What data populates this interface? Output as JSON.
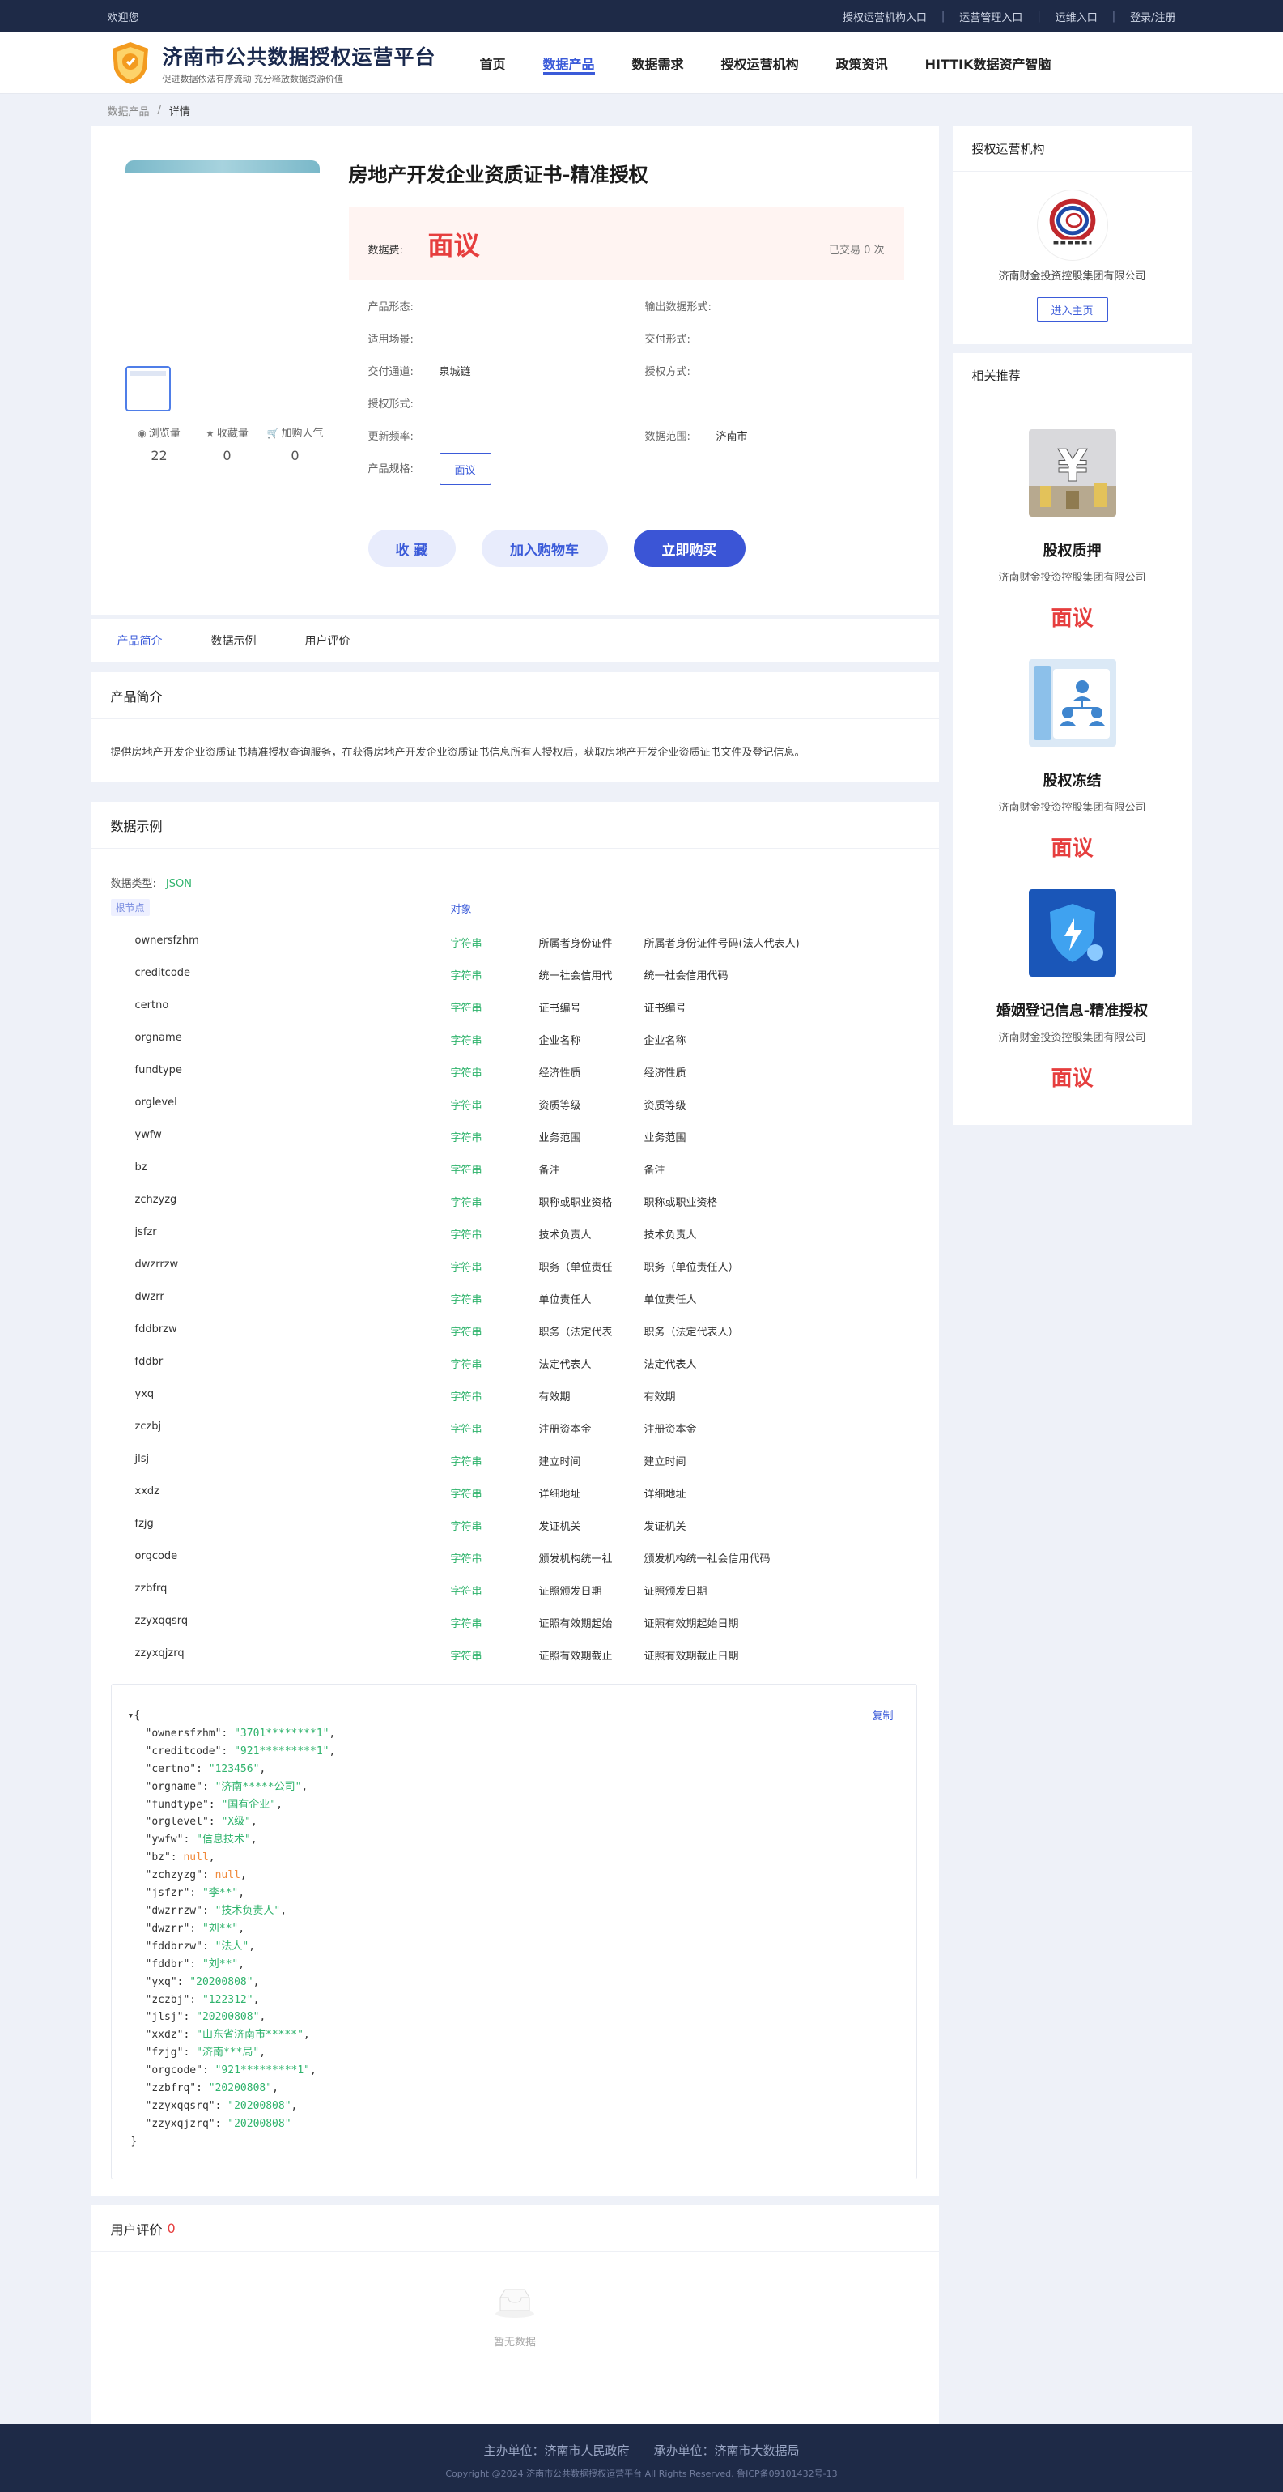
{
  "topbar": {
    "welcome": "欢迎您",
    "links": [
      "授权运营机构入口",
      "运营管理入口",
      "运维入口",
      "登录/注册"
    ]
  },
  "header": {
    "title": "济南市公共数据授权运营平台",
    "slogan": "促进数据依法有序流动 充分释放数据资源价值",
    "nav": [
      "首页",
      "数据产品",
      "数据需求",
      "授权运营机构",
      "政策资讯",
      "HITTIK数据资产智脑"
    ],
    "active_nav": "数据产品"
  },
  "breadcrumb": {
    "parent": "数据产品",
    "sep": "/",
    "current": "详情"
  },
  "product": {
    "title": "房地产开发企业资质证书-精准授权",
    "price_label": "数据费:",
    "price": "面议",
    "deals": "已交易 0 次",
    "stats": [
      {
        "label": "浏览量",
        "icon": "eye-icon",
        "value": "22"
      },
      {
        "label": "收藏量",
        "icon": "star-icon",
        "value": "0"
      },
      {
        "label": "加购人气",
        "icon": "cart-icon",
        "value": "0"
      }
    ],
    "attrs": {
      "form_label": "产品形态:",
      "form_value": "",
      "output_label": "输出数据形式:",
      "output_value": "",
      "scene_label": "适用场景:",
      "scene_value": "",
      "delivery_label": "交付形式:",
      "delivery_value": "",
      "channel_label": "交付通道:",
      "channel_value": "泉城链",
      "auth_method_label": "授权方式:",
      "auth_method_value": "",
      "auth_form_label": "授权形式:",
      "auth_form_value": "",
      "freq_label": "更新频率:",
      "freq_value": "",
      "range_label": "数据范围:",
      "range_value": "济南市",
      "spec_label": "产品规格:",
      "spec_value": "面议"
    },
    "buttons": {
      "fav": "收 藏",
      "cart": "加入购物车",
      "buy": "立即购买"
    }
  },
  "tabs": [
    "产品简介",
    "数据示例",
    "用户评价"
  ],
  "intro": {
    "title": "产品简介",
    "text": "提供房地产开发企业资质证书精准授权查询服务，在获得房地产开发企业资质证书信息所有人授权后，获取房地产开发企业资质证书文件及登记信息。"
  },
  "example": {
    "title": "数据示例",
    "type_label": "数据类型:",
    "type_value": "JSON",
    "root_tag": "根节点",
    "root_type": "对象",
    "fields": [
      {
        "name": "ownersfzhm",
        "type": "字符串",
        "desc": "所属者身份证件",
        "full": "所属者身份证件号码(法人代表人)"
      },
      {
        "name": "creditcode",
        "type": "字符串",
        "desc": "统一社会信用代",
        "full": "统一社会信用代码"
      },
      {
        "name": "certno",
        "type": "字符串",
        "desc": "证书编号",
        "full": "证书编号"
      },
      {
        "name": "orgname",
        "type": "字符串",
        "desc": "企业名称",
        "full": "企业名称"
      },
      {
        "name": "fundtype",
        "type": "字符串",
        "desc": "经济性质",
        "full": "经济性质"
      },
      {
        "name": "orglevel",
        "type": "字符串",
        "desc": "资质等级",
        "full": "资质等级"
      },
      {
        "name": "ywfw",
        "type": "字符串",
        "desc": "业务范围",
        "full": "业务范围"
      },
      {
        "name": "bz",
        "type": "字符串",
        "desc": "备注",
        "full": "备注"
      },
      {
        "name": "zchzyzg",
        "type": "字符串",
        "desc": "职称或职业资格",
        "full": "职称或职业资格"
      },
      {
        "name": "jsfzr",
        "type": "字符串",
        "desc": "技术负责人",
        "full": "技术负责人"
      },
      {
        "name": "dwzrrzw",
        "type": "字符串",
        "desc": "职务（单位责任",
        "full": "职务（单位责任人）"
      },
      {
        "name": "dwzrr",
        "type": "字符串",
        "desc": "单位责任人",
        "full": "单位责任人"
      },
      {
        "name": "fddbrzw",
        "type": "字符串",
        "desc": "职务（法定代表",
        "full": "职务（法定代表人）"
      },
      {
        "name": "fddbr",
        "type": "字符串",
        "desc": "法定代表人",
        "full": "法定代表人"
      },
      {
        "name": "yxq",
        "type": "字符串",
        "desc": "有效期",
        "full": "有效期"
      },
      {
        "name": "zczbj",
        "type": "字符串",
        "desc": "注册资本金",
        "full": "注册资本金"
      },
      {
        "name": "jlsj",
        "type": "字符串",
        "desc": "建立时间",
        "full": "建立时间"
      },
      {
        "name": "xxdz",
        "type": "字符串",
        "desc": "详细地址",
        "full": "详细地址"
      },
      {
        "name": "fzjg",
        "type": "字符串",
        "desc": "发证机关",
        "full": "发证机关"
      },
      {
        "name": "orgcode",
        "type": "字符串",
        "desc": "颁发机构统一社",
        "full": "颁发机构统一社会信用代码"
      },
      {
        "name": "zzbfrq",
        "type": "字符串",
        "desc": "证照颁发日期",
        "full": "证照颁发日期"
      },
      {
        "name": "zzyxqqsrq",
        "type": "字符串",
        "desc": "证照有效期起始",
        "full": "证照有效期起始日期"
      },
      {
        "name": "zzyxqjzrq",
        "type": "字符串",
        "desc": "证照有效期截止",
        "full": "证照有效期截止日期"
      }
    ],
    "copy_label": "复制",
    "json_sample": [
      {
        "key": "ownersfzhm",
        "value": "\"3701********1\"",
        "kind": "str"
      },
      {
        "key": "creditcode",
        "value": "\"921*********1\"",
        "kind": "str"
      },
      {
        "key": "certno",
        "value": "\"123456\"",
        "kind": "str"
      },
      {
        "key": "orgname",
        "value": "\"济南*****公司\"",
        "kind": "str"
      },
      {
        "key": "fundtype",
        "value": "\"国有企业\"",
        "kind": "str"
      },
      {
        "key": "orglevel",
        "value": "\"X级\"",
        "kind": "str"
      },
      {
        "key": "ywfw",
        "value": "\"信息技术\"",
        "kind": "str"
      },
      {
        "key": "bz",
        "value": "null",
        "kind": "null"
      },
      {
        "key": "zchzyzg",
        "value": "null",
        "kind": "null"
      },
      {
        "key": "jsfzr",
        "value": "\"李**\"",
        "kind": "str"
      },
      {
        "key": "dwzrrzw",
        "value": "\"技术负责人\"",
        "kind": "str"
      },
      {
        "key": "dwzrr",
        "value": "\"刘**\"",
        "kind": "str"
      },
      {
        "key": "fddbrzw",
        "value": "\"法人\"",
        "kind": "str"
      },
      {
        "key": "fddbr",
        "value": "\"刘**\"",
        "kind": "str"
      },
      {
        "key": "yxq",
        "value": "\"20200808\"",
        "kind": "str"
      },
      {
        "key": "zczbj",
        "value": "\"122312\"",
        "kind": "str"
      },
      {
        "key": "jlsj",
        "value": "\"20200808\"",
        "kind": "str"
      },
      {
        "key": "xxdz",
        "value": "\"山东省济南市*****\"",
        "kind": "str"
      },
      {
        "key": "fzjg",
        "value": "\"济南***局\"",
        "kind": "str"
      },
      {
        "key": "orgcode",
        "value": "\"921*********1\"",
        "kind": "str"
      },
      {
        "key": "zzbfrq",
        "value": "\"20200808\"",
        "kind": "str"
      },
      {
        "key": "zzyxqqsrq",
        "value": "\"20200808\"",
        "kind": "str"
      },
      {
        "key": "zzyxqjzrq",
        "value": "\"20200808\"",
        "kind": "str"
      }
    ]
  },
  "review": {
    "title": "用户评价",
    "count": "0",
    "empty": "暂无数据"
  },
  "side": {
    "org_title": "授权运营机构",
    "org_name": "济南财金投资控股集团有限公司",
    "home_btn": "进入主页",
    "rec_title": "相关推荐",
    "recs": [
      {
        "name": "股权质押",
        "company": "济南财金投资控股集团有限公司",
        "price": "面议",
        "icon": "yen-icon"
      },
      {
        "name": "股权冻结",
        "company": "济南财金投资控股集团有限公司",
        "price": "面议",
        "icon": "people-icon"
      },
      {
        "name": "婚姻登记信息-精准授权",
        "company": "济南财金投资控股集团有限公司",
        "price": "面议",
        "icon": "shield-icon"
      }
    ]
  },
  "footer": {
    "line1": "主办单位：济南市人民政府　　承办单位：济南市大数据局",
    "line2": "Copyright @2024 济南市公共数据授权运营平台 All Rights Reserved. 鲁ICP备09101432号-13"
  },
  "colors": {
    "brand": "#3b5bd9",
    "price": "#e63e3e",
    "type": "#2fb36c",
    "dark": "#1e2a47"
  }
}
